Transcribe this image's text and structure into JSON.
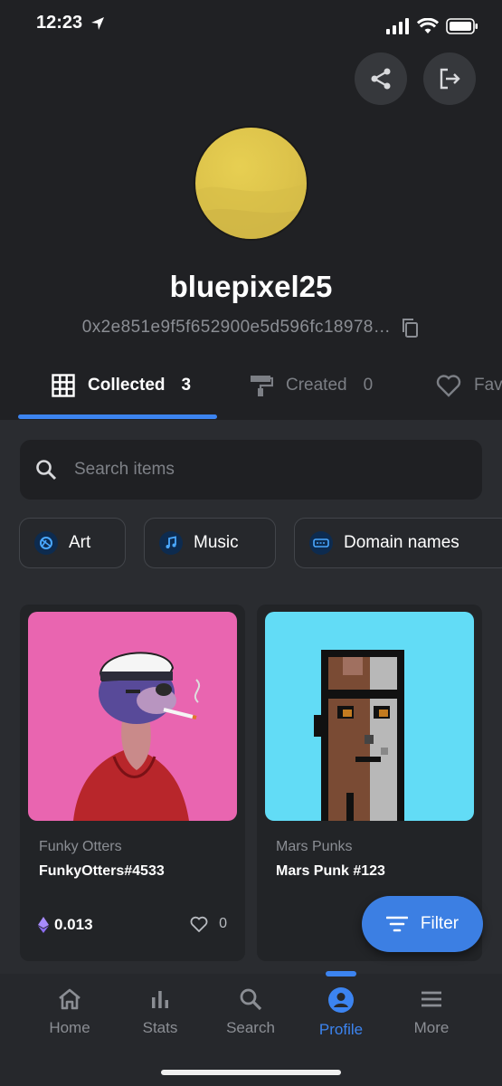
{
  "status_bar": {
    "time": "12:23"
  },
  "profile": {
    "username": "bluepixel25",
    "address": "0x2e851e9f5f652900e5d596fc18978…"
  },
  "tabs": [
    {
      "label": "Collected",
      "count": "3",
      "icon": "grid-icon"
    },
    {
      "label": "Created",
      "count": "0",
      "icon": "paint-roller-icon"
    },
    {
      "label": "Fav",
      "icon": "heart-icon"
    }
  ],
  "search": {
    "placeholder": "Search items"
  },
  "chips": [
    {
      "label": "Art",
      "icon": "art-icon"
    },
    {
      "label": "Music",
      "icon": "music-icon"
    },
    {
      "label": "Domain names",
      "icon": "domain-icon"
    }
  ],
  "cards": [
    {
      "collection": "Funky Otters",
      "name": "FunkyOtters#4533",
      "price": "0.013",
      "likes": "0",
      "bg": "#e965b0"
    },
    {
      "collection": "Mars Punks",
      "name": "Mars Punk #123",
      "bg": "#62dcf6"
    }
  ],
  "filter_button": {
    "label": "Filter"
  },
  "bottom_nav": [
    {
      "label": "Home",
      "icon": "home-icon"
    },
    {
      "label": "Stats",
      "icon": "stats-icon"
    },
    {
      "label": "Search",
      "icon": "search-icon"
    },
    {
      "label": "Profile",
      "icon": "profile-icon",
      "active": true
    },
    {
      "label": "More",
      "icon": "menu-icon"
    }
  ],
  "colors": {
    "accent": "#3c84f0",
    "background": "#202124"
  }
}
